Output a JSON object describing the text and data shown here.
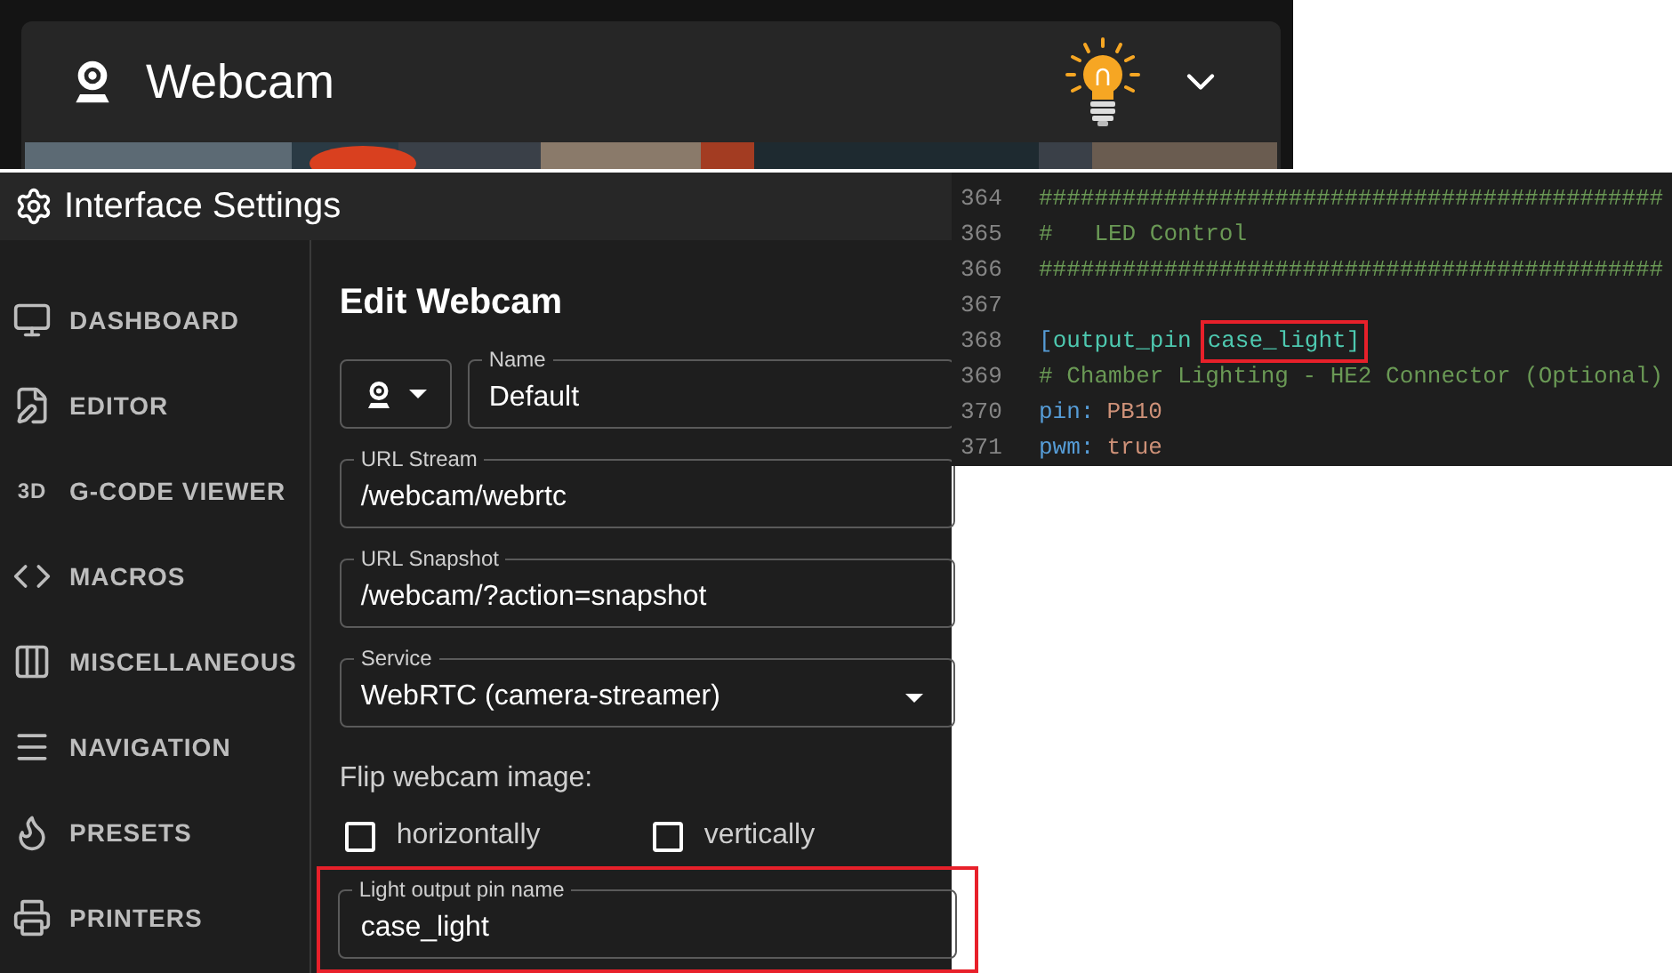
{
  "webcam_card": {
    "title": "Webcam",
    "light_on": true
  },
  "settings": {
    "title": "Interface Settings",
    "sidebar": {
      "items": [
        {
          "label": "DASHBOARD"
        },
        {
          "label": "EDITOR"
        },
        {
          "label": "G-CODE VIEWER",
          "badge": "3D"
        },
        {
          "label": "MACROS"
        },
        {
          "label": "MISCELLANEOUS"
        },
        {
          "label": "NAVIGATION"
        },
        {
          "label": "PRESETS"
        },
        {
          "label": "PRINTERS"
        }
      ]
    },
    "form": {
      "title": "Edit Webcam",
      "name": {
        "label": "Name",
        "value": "Default"
      },
      "fields": [
        {
          "label": "URL Stream",
          "value": "/webcam/webrtc",
          "kind": "text"
        },
        {
          "label": "URL Snapshot",
          "value": "/webcam/?action=snapshot",
          "kind": "text"
        },
        {
          "label": "Service",
          "value": "WebRTC (camera-streamer)",
          "kind": "select"
        }
      ],
      "flip_label": "Flip webcam image:",
      "flip_options": [
        {
          "label": "horizontally",
          "checked": false
        },
        {
          "label": "vertically",
          "checked": false
        }
      ],
      "light_pin": {
        "label": "Light output pin name",
        "value": "case_light",
        "highlighted": true
      }
    }
  },
  "code": {
    "lines": [
      {
        "number": "364",
        "tokens": [
          {
            "text": "#############################################",
            "kind": "comment"
          }
        ]
      },
      {
        "number": "365",
        "tokens": [
          {
            "text": "#   LED Control",
            "kind": "comment"
          }
        ]
      },
      {
        "number": "366",
        "tokens": [
          {
            "text": "#############################################",
            "kind": "comment"
          }
        ]
      },
      {
        "number": "367"
      },
      {
        "number": "368",
        "tokens": [
          {
            "text": "[",
            "kind": "bracket"
          },
          {
            "text": "output_pin",
            "kind": "section"
          },
          {
            "text": "case_light]",
            "kind": "section",
            "highlighted": true
          }
        ]
      },
      {
        "number": "369",
        "tokens": [
          {
            "text": "# Chamber Lighting - HE2 Connector (Optional)",
            "kind": "comment"
          }
        ]
      },
      {
        "number": "370",
        "tokens": [
          {
            "text": "pin:",
            "kind": "key"
          },
          {
            "text": "PB10",
            "kind": "value"
          }
        ]
      },
      {
        "number": "371",
        "tokens": [
          {
            "text": "pwm:",
            "kind": "key"
          },
          {
            "text": "true",
            "kind": "value"
          }
        ]
      }
    ]
  }
}
